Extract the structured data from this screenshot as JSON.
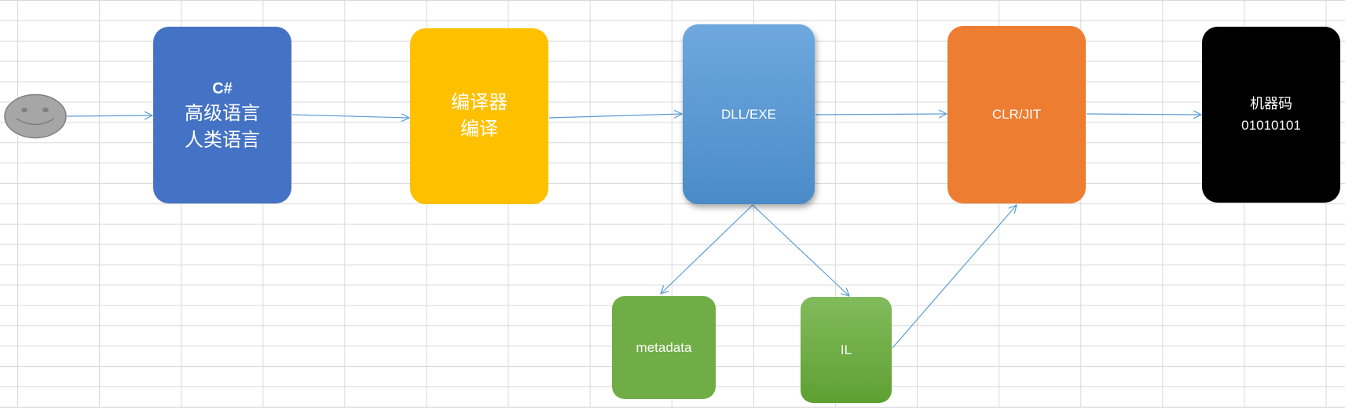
{
  "nodes": {
    "user": {
      "icon": "smiley-face-icon"
    },
    "source": {
      "title": "C#",
      "line1": "高级语言",
      "line2": "人类语言",
      "color": "#4472C4"
    },
    "compiler": {
      "line1": "编译器",
      "line2": "编译",
      "color": "#FFC000"
    },
    "assembly": {
      "label": "DLL/EXE",
      "color": "#5B9BD5"
    },
    "runtime": {
      "label": "CLR/JIT",
      "color": "#ED7D31"
    },
    "machine_code": {
      "line1": "机器码",
      "line2": "01010101",
      "color": "#000000"
    },
    "metadata": {
      "label": "metadata",
      "color": "#70AD47"
    },
    "il": {
      "label": "IL",
      "color": "#70AD47"
    }
  },
  "colors": {
    "arrow": "#5B9BD5",
    "gridline": "#D9D9D9"
  }
}
